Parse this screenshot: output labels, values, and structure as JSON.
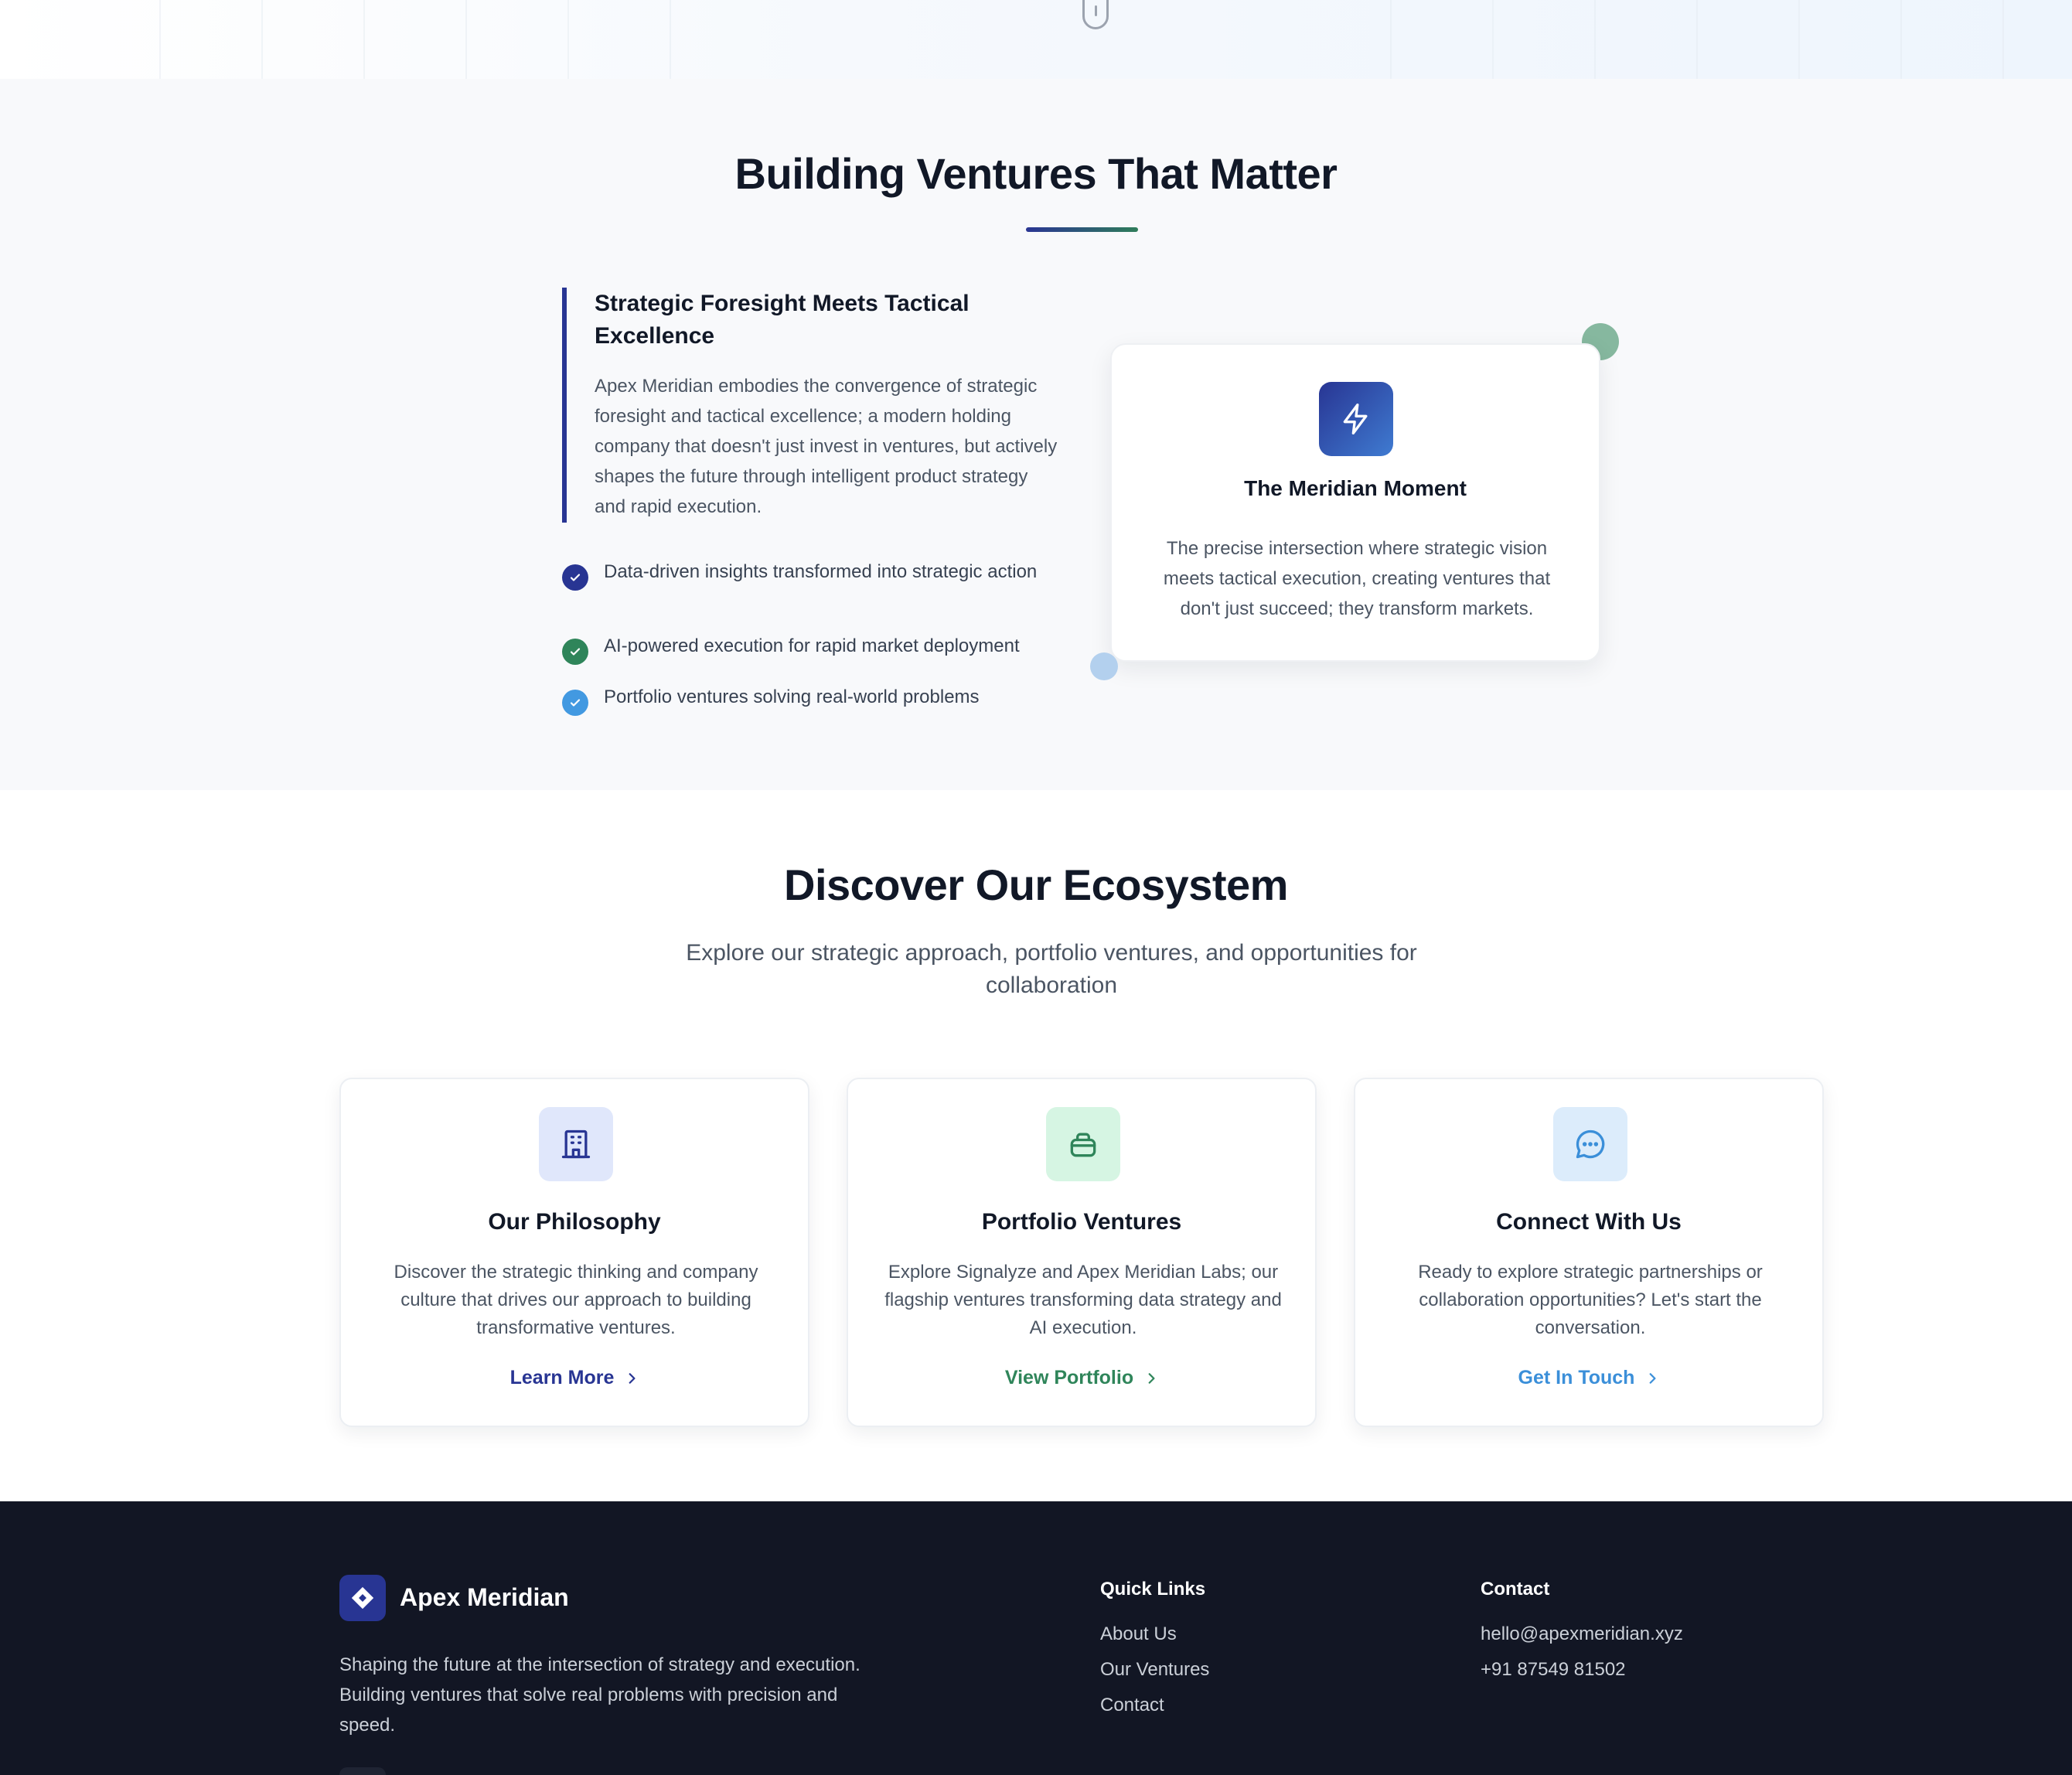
{
  "ventures": {
    "title": "Building Ventures That Matter",
    "quote_heading": "Strategic Foresight Meets Tactical Excellence",
    "quote_body": "Apex Meridian embodies the convergence of strategic foresight and tactical excellence; a modern holding company that doesn't just invest in ventures, but actively shapes the future through intelligent product strategy and rapid execution.",
    "checklist": [
      {
        "text": "Data-driven insights transformed into strategic action",
        "color": "#283593"
      },
      {
        "text": "AI-powered execution for rapid market deployment",
        "color": "#2f855a"
      },
      {
        "text": "Portfolio ventures solving real-world problems",
        "color": "#4299e1"
      }
    ],
    "moment_card": {
      "icon": "lightning-bolt-icon",
      "title": "The Meridian Moment",
      "body": "The precise intersection where strategic vision meets tactical execution, creating ventures that don't just succeed; they transform markets."
    }
  },
  "ecosystem": {
    "title": "Discover Our Ecosystem",
    "subtitle": "Explore our strategic approach, portfolio ventures, and opportunities for collaboration",
    "cards": [
      {
        "icon": "building-icon",
        "title": "Our Philosophy",
        "body": "Discover the strategic thinking and company culture that drives our approach to building transformative ventures.",
        "link": "Learn More",
        "accent": "#283593",
        "tile": "#e0e7fb"
      },
      {
        "icon": "briefcase-icon",
        "title": "Portfolio Ventures",
        "body": "Explore Signalyze and Apex Meridian Labs; our flagship ventures transforming data strategy and AI execution.",
        "link": "View Portfolio",
        "accent": "#2f855a",
        "tile": "#d6f5e3"
      },
      {
        "icon": "chat-bubble-icon",
        "title": "Connect With Us",
        "body": "Ready to explore strategic partnerships or collaboration opportunities? Let's start the conversation.",
        "link": "Get In Touch",
        "accent": "#3b8fd9",
        "tile": "#dcecfb"
      }
    ]
  },
  "footer": {
    "brand": "Apex Meridian",
    "description": "Shaping the future at the intersection of strategy and execution. Building ventures that solve real problems with precision and speed.",
    "quick_links_title": "Quick Links",
    "quick_links": [
      "About Us",
      "Our Ventures",
      "Contact"
    ],
    "contact_title": "Contact",
    "email": "hello@apexmeridian.xyz",
    "phone": "+91 87549 81502"
  },
  "colors": {
    "brand_indigo": "#283593",
    "brand_green": "#2f855a",
    "brand_blue": "#3b8fd9",
    "footer_bg": "#121624"
  }
}
